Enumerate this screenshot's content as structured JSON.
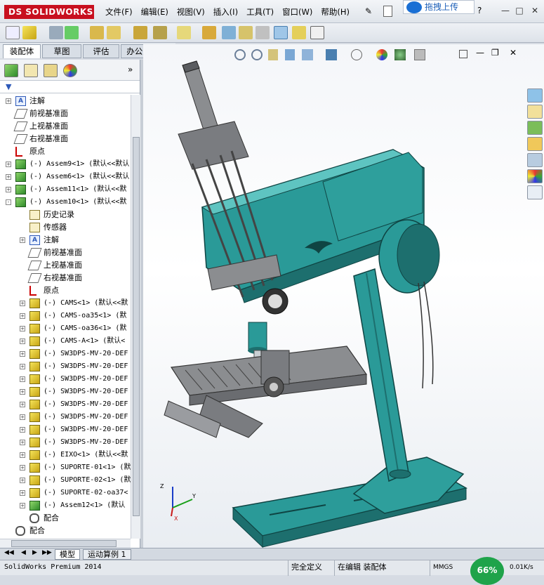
{
  "app": {
    "logo_text": "DS SOLIDWORKS",
    "menu": [
      "文件(F)",
      "编辑(E)",
      "视图(V)",
      "插入(I)",
      "工具(T)",
      "窗口(W)",
      "帮助(H)"
    ],
    "upload_label": "拖拽上传"
  },
  "command_tabs": [
    "装配体",
    "草图",
    "评估",
    "办公室产品"
  ],
  "feature_tree": {
    "rows": [
      {
        "indent": 0,
        "icon": "ann",
        "label": "注解",
        "mono": false,
        "exp": "+"
      },
      {
        "indent": 0,
        "icon": "plane",
        "label": "前视基准面",
        "mono": false,
        "exp": ""
      },
      {
        "indent": 0,
        "icon": "plane",
        "label": "上视基准面",
        "mono": false,
        "exp": ""
      },
      {
        "indent": 0,
        "icon": "plane",
        "label": "右视基准面",
        "mono": false,
        "exp": ""
      },
      {
        "indent": 0,
        "icon": "origin",
        "label": "原点",
        "mono": false,
        "exp": ""
      },
      {
        "indent": 0,
        "icon": "asm",
        "label": "(-) Assem9<1> (默认<<默认",
        "mono": true,
        "exp": "+"
      },
      {
        "indent": 0,
        "icon": "asm",
        "label": "(-) Assem6<1> (默认<<默认",
        "mono": true,
        "exp": "+"
      },
      {
        "indent": 0,
        "icon": "asm",
        "label": "(-) Assem11<1> (默认<<默",
        "mono": true,
        "exp": "+"
      },
      {
        "indent": 0,
        "icon": "asm",
        "label": "(-) Assem10<1> (默认<<默",
        "mono": true,
        "exp": "-"
      },
      {
        "indent": 1,
        "icon": "hist",
        "label": "历史记录",
        "mono": false,
        "exp": ""
      },
      {
        "indent": 1,
        "icon": "hist",
        "label": "传感器",
        "mono": false,
        "exp": ""
      },
      {
        "indent": 1,
        "icon": "ann",
        "label": "注解",
        "mono": false,
        "exp": "+"
      },
      {
        "indent": 1,
        "icon": "plane",
        "label": "前视基准面",
        "mono": false,
        "exp": ""
      },
      {
        "indent": 1,
        "icon": "plane",
        "label": "上视基准面",
        "mono": false,
        "exp": ""
      },
      {
        "indent": 1,
        "icon": "plane",
        "label": "右视基准面",
        "mono": false,
        "exp": ""
      },
      {
        "indent": 1,
        "icon": "origin",
        "label": "原点",
        "mono": false,
        "exp": ""
      },
      {
        "indent": 1,
        "icon": "comp",
        "label": "(-) CAMS<1> (默认<<默",
        "mono": true,
        "exp": "+"
      },
      {
        "indent": 1,
        "icon": "comp",
        "label": "(-) CAMS-oa35<1> (默",
        "mono": true,
        "exp": "+"
      },
      {
        "indent": 1,
        "icon": "comp",
        "label": "(-) CAMS-oa36<1> (默",
        "mono": true,
        "exp": "+"
      },
      {
        "indent": 1,
        "icon": "comp",
        "label": "(-) CAMS-A<1> (默认<",
        "mono": true,
        "exp": "+"
      },
      {
        "indent": 1,
        "icon": "comp",
        "label": "(-) SW3DPS-MV-20-DEF",
        "mono": true,
        "exp": "+"
      },
      {
        "indent": 1,
        "icon": "comp",
        "label": "(-) SW3DPS-MV-20-DEF",
        "mono": true,
        "exp": "+"
      },
      {
        "indent": 1,
        "icon": "comp",
        "label": "(-) SW3DPS-MV-20-DEF",
        "mono": true,
        "exp": "+"
      },
      {
        "indent": 1,
        "icon": "comp",
        "label": "(-) SW3DPS-MV-20-DEF",
        "mono": true,
        "exp": "+"
      },
      {
        "indent": 1,
        "icon": "comp",
        "label": "(-) SW3DPS-MV-20-DEF",
        "mono": true,
        "exp": "+"
      },
      {
        "indent": 1,
        "icon": "comp",
        "label": "(-) SW3DPS-MV-20-DEF",
        "mono": true,
        "exp": "+"
      },
      {
        "indent": 1,
        "icon": "comp",
        "label": "(-) SW3DPS-MV-20-DEF",
        "mono": true,
        "exp": "+"
      },
      {
        "indent": 1,
        "icon": "comp",
        "label": "(-) SW3DPS-MV-20-DEF",
        "mono": true,
        "exp": "+"
      },
      {
        "indent": 1,
        "icon": "comp",
        "label": "(-) EIXO<1> (默认<<默",
        "mono": true,
        "exp": "+"
      },
      {
        "indent": 1,
        "icon": "comp",
        "label": "(-) SUPORTE-01<1> (默",
        "mono": true,
        "exp": "+"
      },
      {
        "indent": 1,
        "icon": "comp",
        "label": "(-) SUPORTE-02<1> (默",
        "mono": true,
        "exp": "+"
      },
      {
        "indent": 1,
        "icon": "comp",
        "label": "(-) SUPORTE-02-oa37<",
        "mono": true,
        "exp": "+"
      },
      {
        "indent": 1,
        "icon": "asm",
        "label": "(-) Assem12<1> (默认",
        "mono": true,
        "exp": "+"
      },
      {
        "indent": 1,
        "icon": "mate",
        "label": "配合",
        "mono": false,
        "exp": ""
      },
      {
        "indent": 0,
        "icon": "mate",
        "label": "配合",
        "mono": false,
        "exp": ""
      }
    ]
  },
  "bottom_tabs": [
    "模型",
    "运动算例 1"
  ],
  "status": {
    "product": "SolidWorks Premium 2014",
    "state": "完全定义",
    "mode": "在编辑 装配体",
    "units": "MMGS",
    "gauge": "66%",
    "speed": "0.01K/s"
  },
  "colors": {
    "machine_teal": "#2a9a98",
    "machine_dark": "#1d6f6e",
    "fixture_gray": "#8b8d90",
    "logo_red": "#c8101f"
  }
}
